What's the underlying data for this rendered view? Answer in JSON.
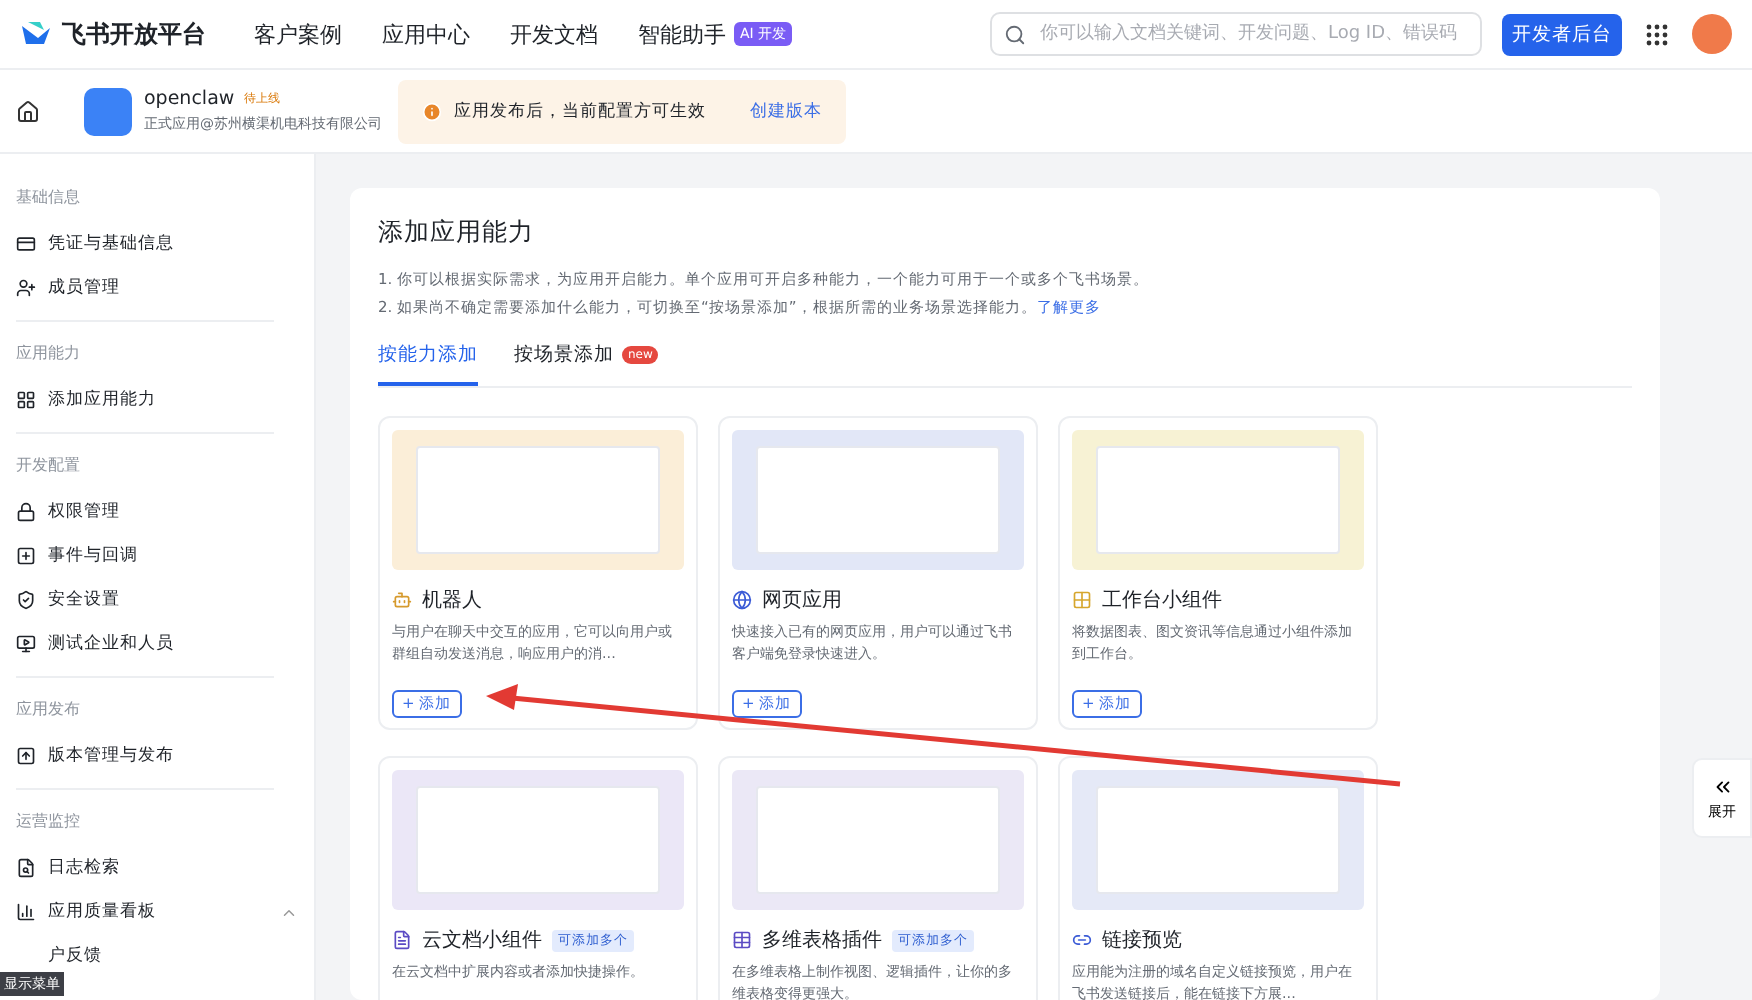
{
  "topbar": {
    "logo": "飞书开放平台",
    "nav": [
      {
        "label": "客户案例"
      },
      {
        "label": "应用中心"
      },
      {
        "label": "开发文档"
      },
      {
        "label": "智能助手",
        "badge": "AI 开发"
      }
    ],
    "search": {
      "placeholder": "你可以输入文档关键词、开发问题、Log ID、错误码"
    },
    "console_button": "开发者后台"
  },
  "app_bar": {
    "app_name": "openclaw",
    "status": "待上线",
    "subtitle": "正式应用@苏州横渠机电科技有限公司",
    "notice": "应用发布后，当前配置方可生效",
    "notice_link": "创建版本"
  },
  "sidebar": {
    "groups": [
      {
        "title": "基础信息",
        "items": [
          {
            "kind": "card",
            "label": "凭证与基础信息",
            "selected": false
          },
          {
            "kind": "person",
            "label": "成员管理",
            "selected": false
          }
        ]
      },
      {
        "title": "应用能力",
        "items": [
          {
            "kind": "grid",
            "label": "添加应用能力",
            "selected": false
          }
        ]
      },
      {
        "title": "开发配置",
        "items": [
          {
            "kind": "lock",
            "label": "权限管理",
            "selected": false
          },
          {
            "kind": "event",
            "label": "事件与回调",
            "selected": false
          },
          {
            "kind": "shield",
            "label": "安全设置",
            "selected": false
          },
          {
            "kind": "test",
            "label": "测试企业和人员",
            "selected": false
          }
        ]
      },
      {
        "title": "应用发布",
        "items": [
          {
            "kind": "upload",
            "label": "版本管理与发布",
            "selected": false
          }
        ]
      },
      {
        "title": "运营监控",
        "items": [
          {
            "kind": "search",
            "label": "日志检索",
            "selected": false
          },
          {
            "kind": "chart",
            "label": "应用质量看板",
            "selected": false,
            "expanded": true
          },
          {
            "kind": "none",
            "label": "户反馈",
            "selected": false
          }
        ]
      }
    ],
    "menu_tag": "显示菜单"
  },
  "main": {
    "title": "添加应用能力",
    "notes": [
      "1. 你可以根据实际需求，为应用开启能力。单个应用可开启多种能力，一个能力可用于一个或多个飞书场景。",
      "2. 如果尚不确定需要添加什么能力，可切换至“按场景添加”，根据所需的业务场景选择能力。"
    ],
    "learn_more": "了解更多",
    "tabs": [
      {
        "label": "按能力添加",
        "selected": true
      },
      {
        "label": "按场景添加",
        "selected": false,
        "badge": "new"
      }
    ],
    "cards": [
      {
        "kind": "robot",
        "title": "机器人",
        "description": "与用户在聊天中交互的应用，它可以向用户或群组自动发送消息，响应用户的消...",
        "add": "+ 添加"
      },
      {
        "kind": "web",
        "title": "网页应用",
        "description": "快速接入已有的网页应用，用户可以通过飞书客户端免登录快速进入。",
        "add": "+ 添加"
      },
      {
        "kind": "widget",
        "title": "工作台小组件",
        "description": "将数据图表、图文资讯等信息通过小组件添加到工作台。",
        "add": "+ 添加"
      },
      {
        "kind": "doc",
        "title": "云文档小组件",
        "badge": "可添加多个",
        "description": "在云文档中扩展内容或者添加快捷操作。"
      },
      {
        "kind": "table",
        "title": "多维表格插件",
        "badge": "可添加多个",
        "description": "在多维表格上制作视图、逻辑插件，让你的多维表格变得更强大。"
      },
      {
        "kind": "link",
        "title": "链接预览",
        "description": "应用能为注册的域名自定义链接预览，用户在飞书发送链接后，能在链接下方展..."
      }
    ]
  },
  "expand_button": "展开"
}
